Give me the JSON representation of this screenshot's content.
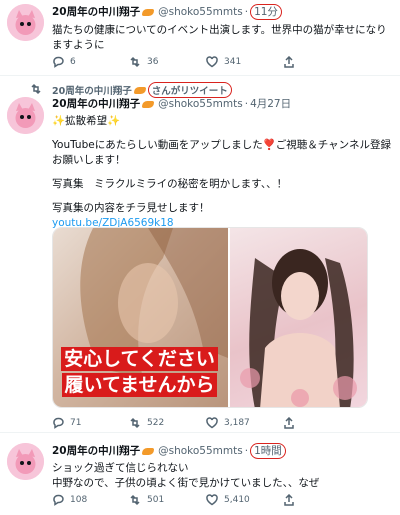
{
  "tweet1": {
    "name": "20周年の中川翔子",
    "handle": "@shoko55mmts",
    "time": "11分",
    "text": "猫たちの健康についてのイベント出演します。世界中の猫が幸せになりますように",
    "actions": {
      "reply": "6",
      "retweet": "36",
      "like": "341"
    }
  },
  "tweet2": {
    "retweeted_by_name": "20周年の中川翔子",
    "retweeted_by_suffix": "さんがリツイート",
    "name": "20周年の中川翔子",
    "handle": "@shoko55mmts",
    "time": "4月27日",
    "line1": "✨拡散希望✨",
    "line2": "YouTubeにあたらしい動画をアップしました❣️ご視聴＆チャンネル登録お願いします！",
    "line3": "写真集　ミラクルミライの秘密を明かします、、！",
    "line4": "写真集の内容をチラ見せします！",
    "link": "youtu.be/ZDjA6569k18",
    "caption_line1": "安心してください",
    "caption_line2": "履いてませんから",
    "actions": {
      "reply": "71",
      "retweet": "522",
      "like": "3,187"
    }
  },
  "tweet3": {
    "name": "20周年の中川翔子",
    "handle": "@shoko55mmts",
    "time": "1時間",
    "line1": "ショック過ぎて信じられない",
    "line2": "中野なので、子供の頃よく街で見かけていました、、なぜ",
    "actions": {
      "reply": "108",
      "retweet": "501",
      "like": "5,410"
    }
  },
  "colors": {
    "accent": "#1d9bf0",
    "annotation": "#d9231e",
    "muted": "#536471"
  },
  "icons": [
    "reply-icon",
    "retweet-icon",
    "like-icon",
    "share-icon"
  ]
}
